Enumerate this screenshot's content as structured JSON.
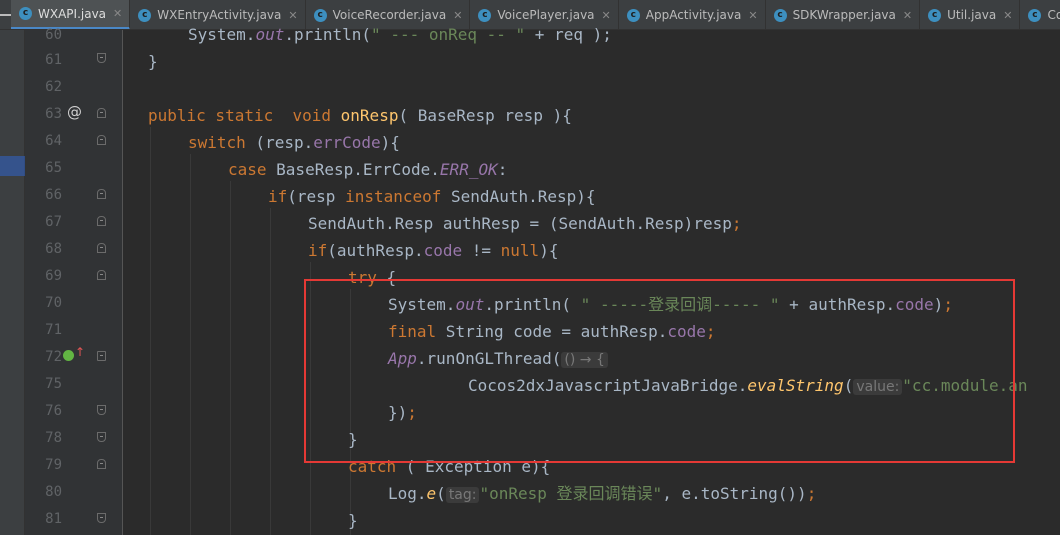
{
  "tabs": [
    {
      "name": "WXAPI.java",
      "active": true
    },
    {
      "name": "WXEntryActivity.java",
      "active": false
    },
    {
      "name": "VoiceRecorder.java",
      "active": false
    },
    {
      "name": "VoicePlayer.java",
      "active": false
    },
    {
      "name": "AppActivity.java",
      "active": false
    },
    {
      "name": "SDKWrapper.java",
      "active": false
    },
    {
      "name": "Util.java",
      "active": false
    },
    {
      "name": "Config",
      "active": false
    }
  ],
  "tab_icon_letter": "c",
  "line_numbers": [
    "60",
    "61",
    "62",
    "63",
    "64",
    "65",
    "66",
    "67",
    "68",
    "69",
    "70",
    "71",
    "72",
    "75",
    "76",
    "78",
    "79",
    "80",
    "81"
  ],
  "code": {
    "l60_a": "System.",
    "l60_b": "out",
    "l60_c": ".println(",
    "l60_d": "\" --- onReq -- \"",
    "l60_e": " + req );",
    "l61": "}",
    "l63_kw": "public static  void ",
    "l63_fn": "onResp",
    "l63_rest": "( BaseResp resp ){",
    "l64_kw": "switch",
    "l64_a": " (resp.",
    "l64_fld": "errCode",
    "l64_b": "){",
    "l65_kw": "case",
    "l65_a": " BaseResp.ErrCode.",
    "l65_fld": "ERR_OK",
    "l65_b": ":",
    "l66_kw": "if",
    "l66_a": "(resp ",
    "l66_kw2": "instanceof",
    "l66_b": " SendAuth.Resp){",
    "l67_a": "SendAuth.Resp authResp = (SendAuth.Resp)resp",
    "l67_b": ";",
    "l68_kw": "if",
    "l68_a": "(authResp.",
    "l68_fld": "code",
    "l68_b": " != ",
    "l68_kw2": "null",
    "l68_c": "){",
    "l69_kw": "try",
    "l69_a": " {",
    "l70_a": "System.",
    "l70_fld": "out",
    "l70_b": ".println( ",
    "l70_str": "\" -----登录回调----- \"",
    "l70_c": " + authResp.",
    "l70_fld2": "code",
    "l70_d": ")",
    "l70_e": ";",
    "l71_kw": "final",
    "l71_a": " String code = authResp.",
    "l71_fld": "code",
    "l71_b": ";",
    "l72_fld": "App",
    "l72_a": ".runOnGLThread(",
    "l72_hint": "() → {",
    "l75_a": "Cocos2dxJavascriptJavaBridge.",
    "l75_fn": "evalString",
    "l75_b": "(",
    "l75_hint": "value:",
    "l75_str": "\"cc.module.an",
    "l76_a": "})",
    "l76_b": ";",
    "l78": "}",
    "l79_kw": "catch",
    "l79_a": " ( Exception e){",
    "l80_a": "Log.",
    "l80_fn": "e",
    "l80_b": "(",
    "l80_hint": "tag:",
    "l80_str": "\"onResp 登录回调错误\"",
    "l80_c": ", e.toString())",
    "l80_d": ";",
    "l81": "}"
  },
  "colors": {
    "keyword": "#cc7832",
    "function": "#ffc66d",
    "field": "#9876aa",
    "string": "#6a8759",
    "text": "#a9b7c6",
    "highlight_box": "#e53935"
  }
}
